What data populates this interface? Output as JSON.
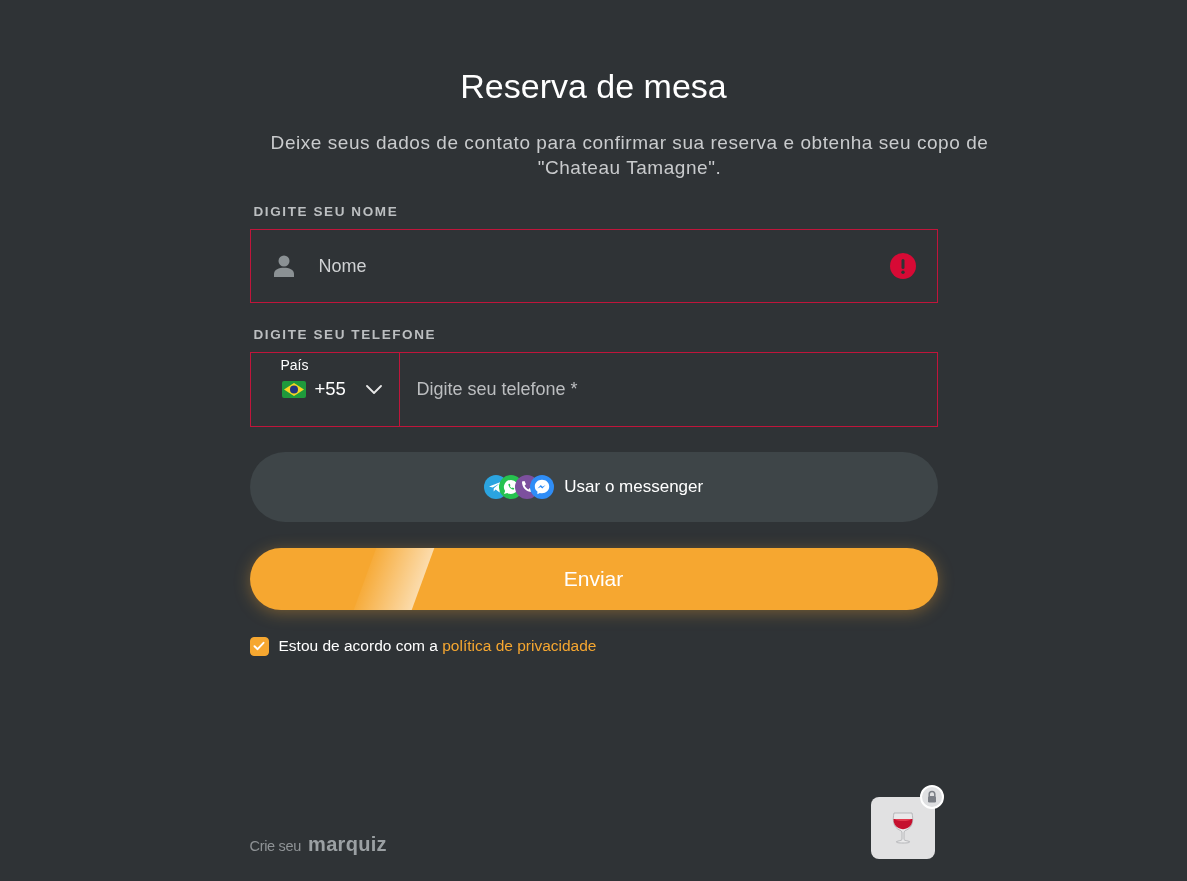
{
  "header": {
    "title": "Reserva de mesa",
    "subtitle": "Deixe seus dados de contato para confirmar sua reserva e obtenha seu copo de \"Chateau Tamagne\"."
  },
  "name_field": {
    "label": "DIGITE SEU NOME",
    "placeholder": "Nome",
    "error": true
  },
  "phone_field": {
    "label": "DIGITE SEU TELEFONE",
    "country_label": "País",
    "country_code": "+55",
    "placeholder": "Digite seu telefone *",
    "error": true
  },
  "messenger_button": {
    "label": "Usar o messenger"
  },
  "submit_button": {
    "label": "Enviar"
  },
  "consent": {
    "checked": true,
    "text": "Estou de acordo com a ",
    "link": "política de privacidade"
  },
  "footer": {
    "prefix": "Crie seu",
    "brand": "marquiz"
  },
  "widget": {
    "locked": true
  }
}
